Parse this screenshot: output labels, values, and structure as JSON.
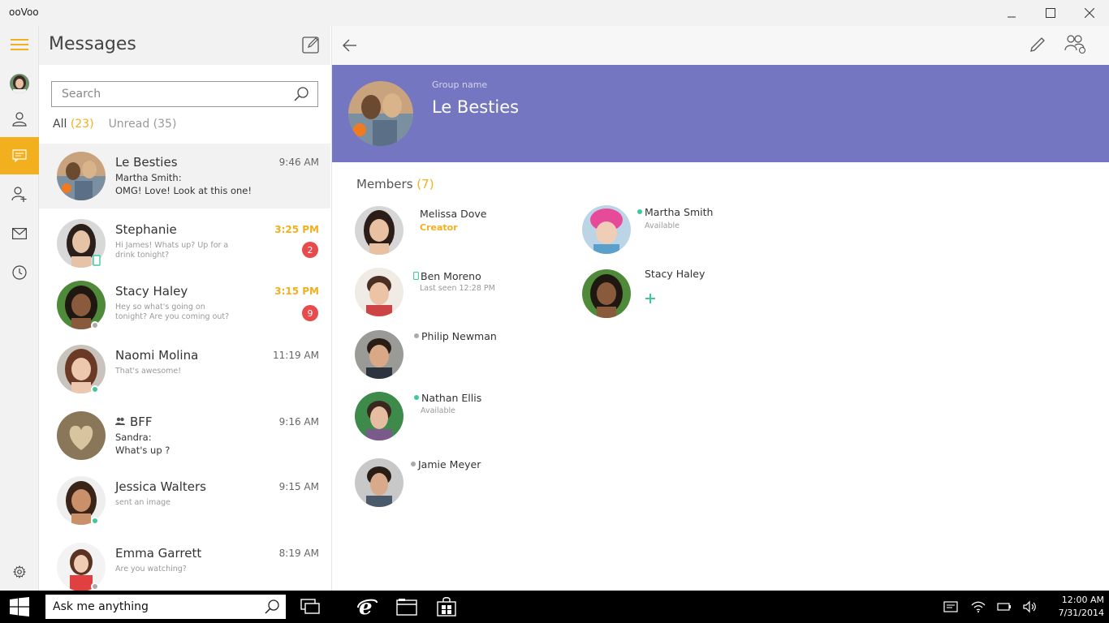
{
  "window": {
    "title": "ooVoo"
  },
  "messages": {
    "title": "Messages",
    "search_placeholder": "Search",
    "filters": [
      {
        "label": "All",
        "count": "(23)"
      },
      {
        "label": "Unread",
        "count": "(35)"
      }
    ],
    "conversations": [
      {
        "name": "Le Besties",
        "time": "9:46 AM",
        "sender": "Martha Smith:",
        "preview": "OMG! Love! Look at this one!"
      },
      {
        "name": "Stephanie",
        "time": "3:25 PM",
        "preview": "Hi James! Whats up? Up for a drink tonight?",
        "badge": "2"
      },
      {
        "name": "Stacy Haley",
        "time": "3:15 PM",
        "preview": "Hey so what's going on tonight? Are you coming out?",
        "badge": "9"
      },
      {
        "name": "Naomi Molina",
        "time": "11:19 AM",
        "preview": "That's awesome!"
      },
      {
        "name": "BFF",
        "time": "9:16 AM",
        "sender": "Sandra:",
        "preview": "What's up ?"
      },
      {
        "name": "Jessica Walters",
        "time": "9:15 AM",
        "preview": "sent an image"
      },
      {
        "name": "Emma Garrett",
        "time": "8:19 AM",
        "preview": "Are you watching?"
      }
    ]
  },
  "group": {
    "label": "Group name",
    "name": "Le Besties",
    "members_label": "Members",
    "members_count": "(7)",
    "members": [
      {
        "name": "Melissa Dove",
        "sub": "Creator"
      },
      {
        "name": "Martha Smith",
        "sub": "Available"
      },
      {
        "name": "Ben Moreno",
        "sub": "Last seen 12:28 PM"
      },
      {
        "name": "Stacy Haley",
        "sub": ""
      },
      {
        "name": "Philip Newman",
        "sub": ""
      },
      {
        "name": "Nathan Ellis",
        "sub": "Available"
      },
      {
        "name": "Jamie Meyer",
        "sub": ""
      }
    ]
  },
  "taskbar": {
    "search_placeholder": "Ask me anything",
    "time": "12:00 AM",
    "date": "7/31/2014"
  },
  "colors": {
    "accent": "#f2b01e",
    "group_header": "#7576c1",
    "online": "#3ec99b",
    "offline": "#aaaaaa",
    "badge": "#e84b4b"
  }
}
